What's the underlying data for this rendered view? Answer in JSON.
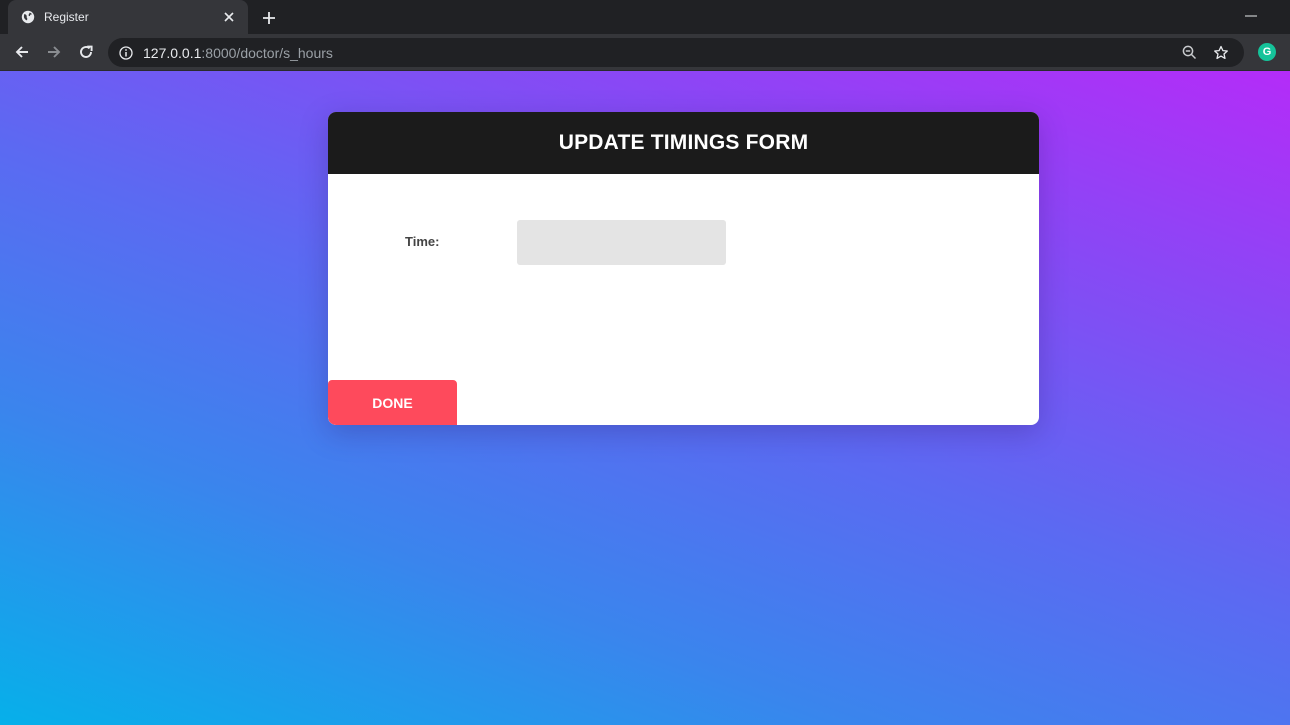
{
  "browser": {
    "tab": {
      "title": "Register",
      "favicon": "globe-icon"
    },
    "address_bar": {
      "host": "127.0.0.1",
      "path": ":8000/doctor/s_hours"
    },
    "extension": {
      "letter": "G",
      "color": "#15c39a"
    }
  },
  "page": {
    "background_colors": [
      "#06b0ea",
      "#5c69f2",
      "#b42cf8"
    ],
    "form": {
      "title": "UPDATE TIMINGS FORM",
      "header_color": "#1b1b1b",
      "time_label": "Time:",
      "time_value": "",
      "submit_label": "DONE",
      "submit_color": "#fe4a5c"
    }
  }
}
